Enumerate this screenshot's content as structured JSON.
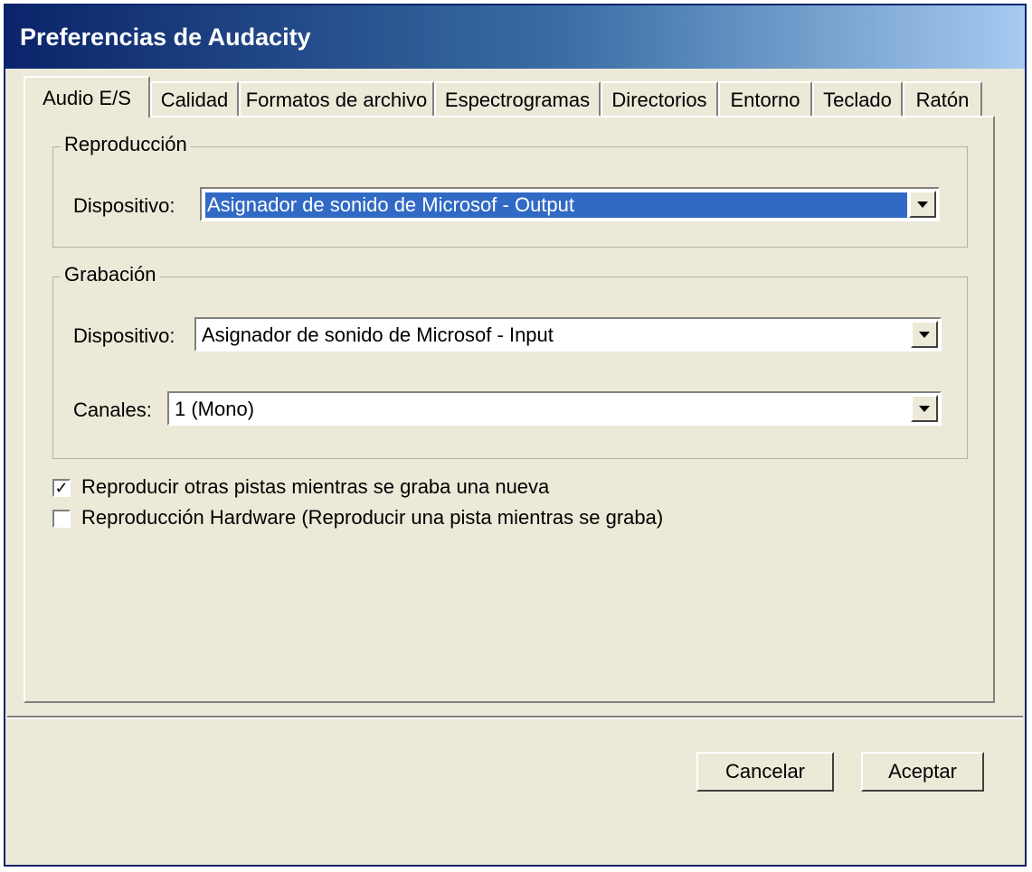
{
  "window": {
    "title": "Preferencias de Audacity"
  },
  "tabs": [
    {
      "label": "Audio E/S",
      "active": true
    },
    {
      "label": "Calidad"
    },
    {
      "label": "Formatos de archivo"
    },
    {
      "label": "Espectrogramas"
    },
    {
      "label": "Directorios"
    },
    {
      "label": "Entorno"
    },
    {
      "label": "Teclado"
    },
    {
      "label": "Ratón"
    }
  ],
  "playback": {
    "group_label": "Reproducción",
    "device_label": "Dispositivo:",
    "device_value": "Asignador de sonido de Microsof - Output"
  },
  "recording": {
    "group_label": "Grabación",
    "device_label": "Dispositivo:",
    "device_value": "Asignador de sonido de Microsof - Input",
    "channels_label": "Canales:",
    "channels_value": "1 (Mono)"
  },
  "options": [
    {
      "label": "Reproducir otras pistas mientras se graba una nueva",
      "checked": true
    },
    {
      "label": "Reproducción Hardware (Reproducir una pista mientras se graba)",
      "checked": false
    }
  ],
  "buttons": {
    "cancel": "Cancelar",
    "ok": "Aceptar"
  },
  "colors": {
    "titlebar": "#0a246a",
    "selection": "#316ac5",
    "face": "#ece9d8"
  }
}
